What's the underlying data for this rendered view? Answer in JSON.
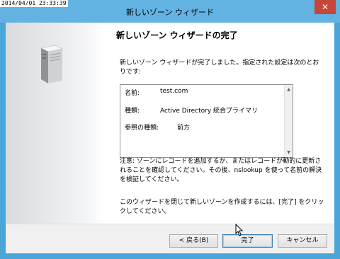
{
  "timestamp": "2014/04/01 23:33:39",
  "window": {
    "title": "新しいゾーン ウィザード",
    "close_glyph": "✕"
  },
  "heading": "新しいゾーン ウィザードの完了",
  "intro": "新しいゾーン ウィザードが完了しました。指定された設定は次のとおりです:",
  "summary": [
    {
      "label": "名前:",
      "value": "test.com"
    },
    {
      "label": "種類:",
      "value": "Active Directory 統合プライマリ"
    },
    {
      "label": "参照の種類:",
      "value": "前方"
    }
  ],
  "note": "注意: ゾーンにレコードを追加するか、またはレコードが動的に更新されることを確認してください。その後、nslookup を使って名前の解決を検証してください。",
  "closing": "このウィザードを閉じて新しいゾーンを作成するには、[完了] をクリックしてください。",
  "buttons": {
    "back": "< 戻る(B)",
    "finish": "完了",
    "cancel": "キャンセル"
  },
  "icons": {
    "side": "server-icon",
    "scroll_up": "scroll-up-arrow-icon",
    "scroll_down": "scroll-down-arrow-icon",
    "cursor": "mouse-cursor-icon"
  },
  "colors": {
    "frame": "#62b3e2",
    "close": "#c7463a",
    "default_button_border": "#3c7fb1"
  }
}
